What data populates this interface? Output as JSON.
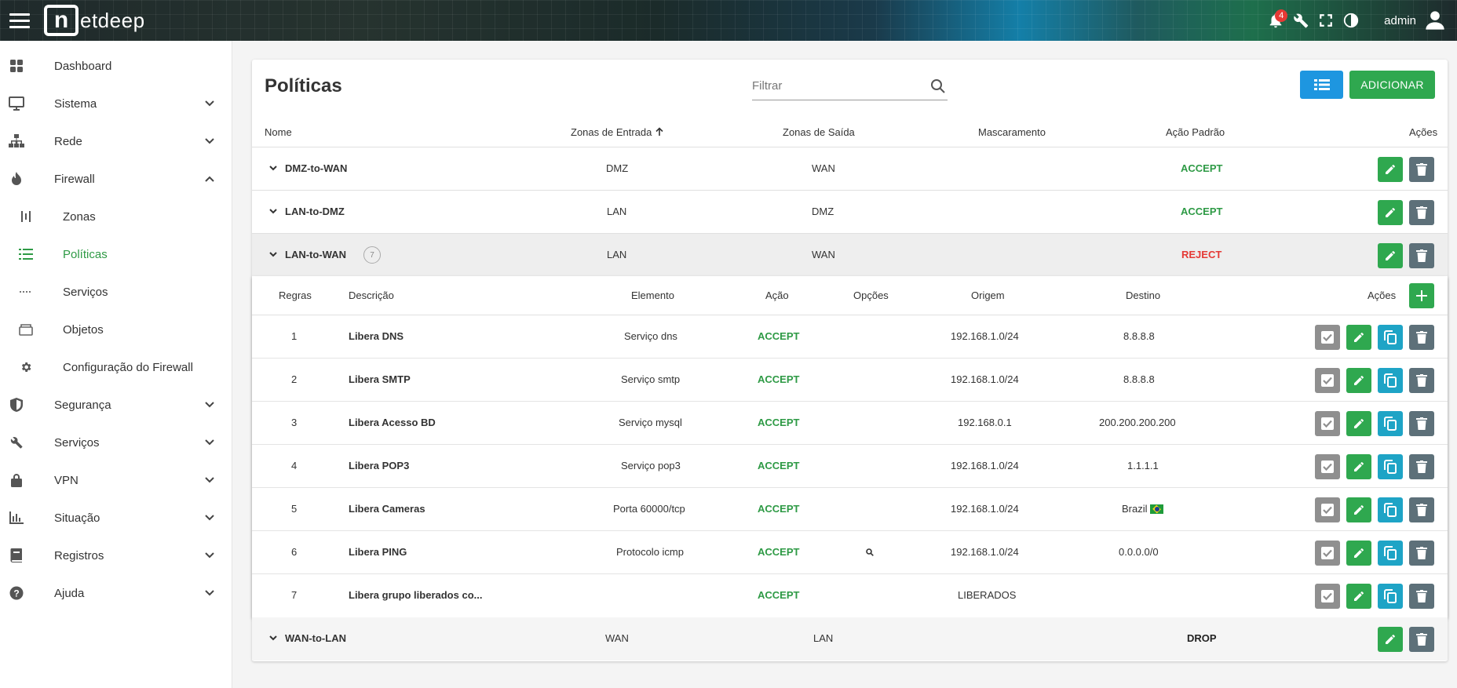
{
  "header": {
    "brand": "etdeep",
    "brand_mark": "n",
    "notification_count": "4",
    "user": "admin",
    "icons": [
      "menu-icon",
      "bell-icon",
      "tools-icon",
      "fullscreen-icon",
      "contrast-icon",
      "user-icon"
    ]
  },
  "sidebar": {
    "items": [
      {
        "label": "Dashboard",
        "icon": "dashboard-icon"
      },
      {
        "label": "Sistema",
        "icon": "monitor-icon"
      },
      {
        "label": "Rede",
        "icon": "network-icon"
      },
      {
        "label": "Firewall",
        "icon": "fire-icon"
      },
      {
        "label": "Zonas",
        "icon": "zones-icon"
      },
      {
        "label": "Políticas",
        "icon": "list-icon"
      },
      {
        "label": "Serviços",
        "icon": "dots-icon"
      },
      {
        "label": "Objetos",
        "icon": "box-icon"
      },
      {
        "label": "Configuração do Firewall",
        "icon": "gear-icon"
      },
      {
        "label": "Segurança",
        "icon": "shield-icon"
      },
      {
        "label": "Serviços",
        "icon": "wrench-icon"
      },
      {
        "label": "VPN",
        "icon": "lock-icon"
      },
      {
        "label": "Situação",
        "icon": "bar-chart-icon"
      },
      {
        "label": "Registros",
        "icon": "book-icon"
      },
      {
        "label": "Ajuda",
        "icon": "help-icon"
      }
    ],
    "active": "Políticas",
    "accent": "#2e9a45"
  },
  "main": {
    "title": "Políticas",
    "filter_placeholder": "Filtrar",
    "add_label": "ADICIONAR",
    "columns": {
      "name": "Nome",
      "in_zones": "Zonas de Entrada",
      "out_zones": "Zonas de Saída",
      "masquerade": "Mascaramento",
      "default_action": "Ação Padrão",
      "actions": "Ações"
    },
    "policies": [
      {
        "name": "DMZ-to-WAN",
        "in": "DMZ",
        "out": "WAN",
        "action": "ACCEPT"
      },
      {
        "name": "LAN-to-DMZ",
        "in": "LAN",
        "out": "DMZ",
        "action": "ACCEPT"
      },
      {
        "name": "LAN-to-WAN",
        "count": "7",
        "in": "LAN",
        "out": "WAN",
        "action": "REJECT"
      },
      {
        "name": "WAN-to-LAN",
        "in": "WAN",
        "out": "LAN",
        "action": "DROP"
      }
    ],
    "rule_columns": {
      "rules": "Regras",
      "description": "Descrição",
      "element": "Elemento",
      "action": "Ação",
      "options": "Opções",
      "origin": "Origem",
      "destination": "Destino",
      "actions": "Ações"
    },
    "rules": [
      {
        "n": "1",
        "desc": "Libera DNS",
        "el": "Serviço dns",
        "action": "ACCEPT",
        "opt": "",
        "orig": "192.168.1.0/24",
        "dest": "8.8.8.8"
      },
      {
        "n": "2",
        "desc": "Libera SMTP",
        "el": "Serviço smtp",
        "action": "ACCEPT",
        "opt": "",
        "orig": "192.168.1.0/24",
        "dest": "8.8.8.8"
      },
      {
        "n": "3",
        "desc": "Libera Acesso BD",
        "el": "Serviço mysql",
        "action": "ACCEPT",
        "opt": "",
        "orig": "192.168.0.1",
        "dest": "200.200.200.200"
      },
      {
        "n": "4",
        "desc": "Libera POP3",
        "el": "Serviço pop3",
        "action": "ACCEPT",
        "opt": "",
        "orig": "192.168.1.0/24",
        "dest": "1.1.1.1"
      },
      {
        "n": "5",
        "desc": "Libera Cameras",
        "el": "Porta 60000/tcp",
        "action": "ACCEPT",
        "opt": "",
        "orig": "192.168.1.0/24",
        "dest": "Brazil"
      },
      {
        "n": "6",
        "desc": "Libera PING",
        "el": "Protocolo icmp",
        "action": "ACCEPT",
        "opt": "search-icon",
        "orig": "192.168.1.0/24",
        "dest": "0.0.0.0/0"
      },
      {
        "n": "7",
        "desc": "Libera grupo liberados co...",
        "el": "",
        "action": "ACCEPT",
        "opt": "",
        "orig": "LIBERADOS",
        "dest": ""
      }
    ]
  },
  "colors": {
    "accept": "#2e9a45",
    "reject": "#e53935",
    "edit_button": "#2fa84f",
    "delete_button": "#5d7079",
    "copy_button": "#1ea4c6",
    "check_button": "#8f8f8f",
    "list_button": "#1e96e0"
  }
}
